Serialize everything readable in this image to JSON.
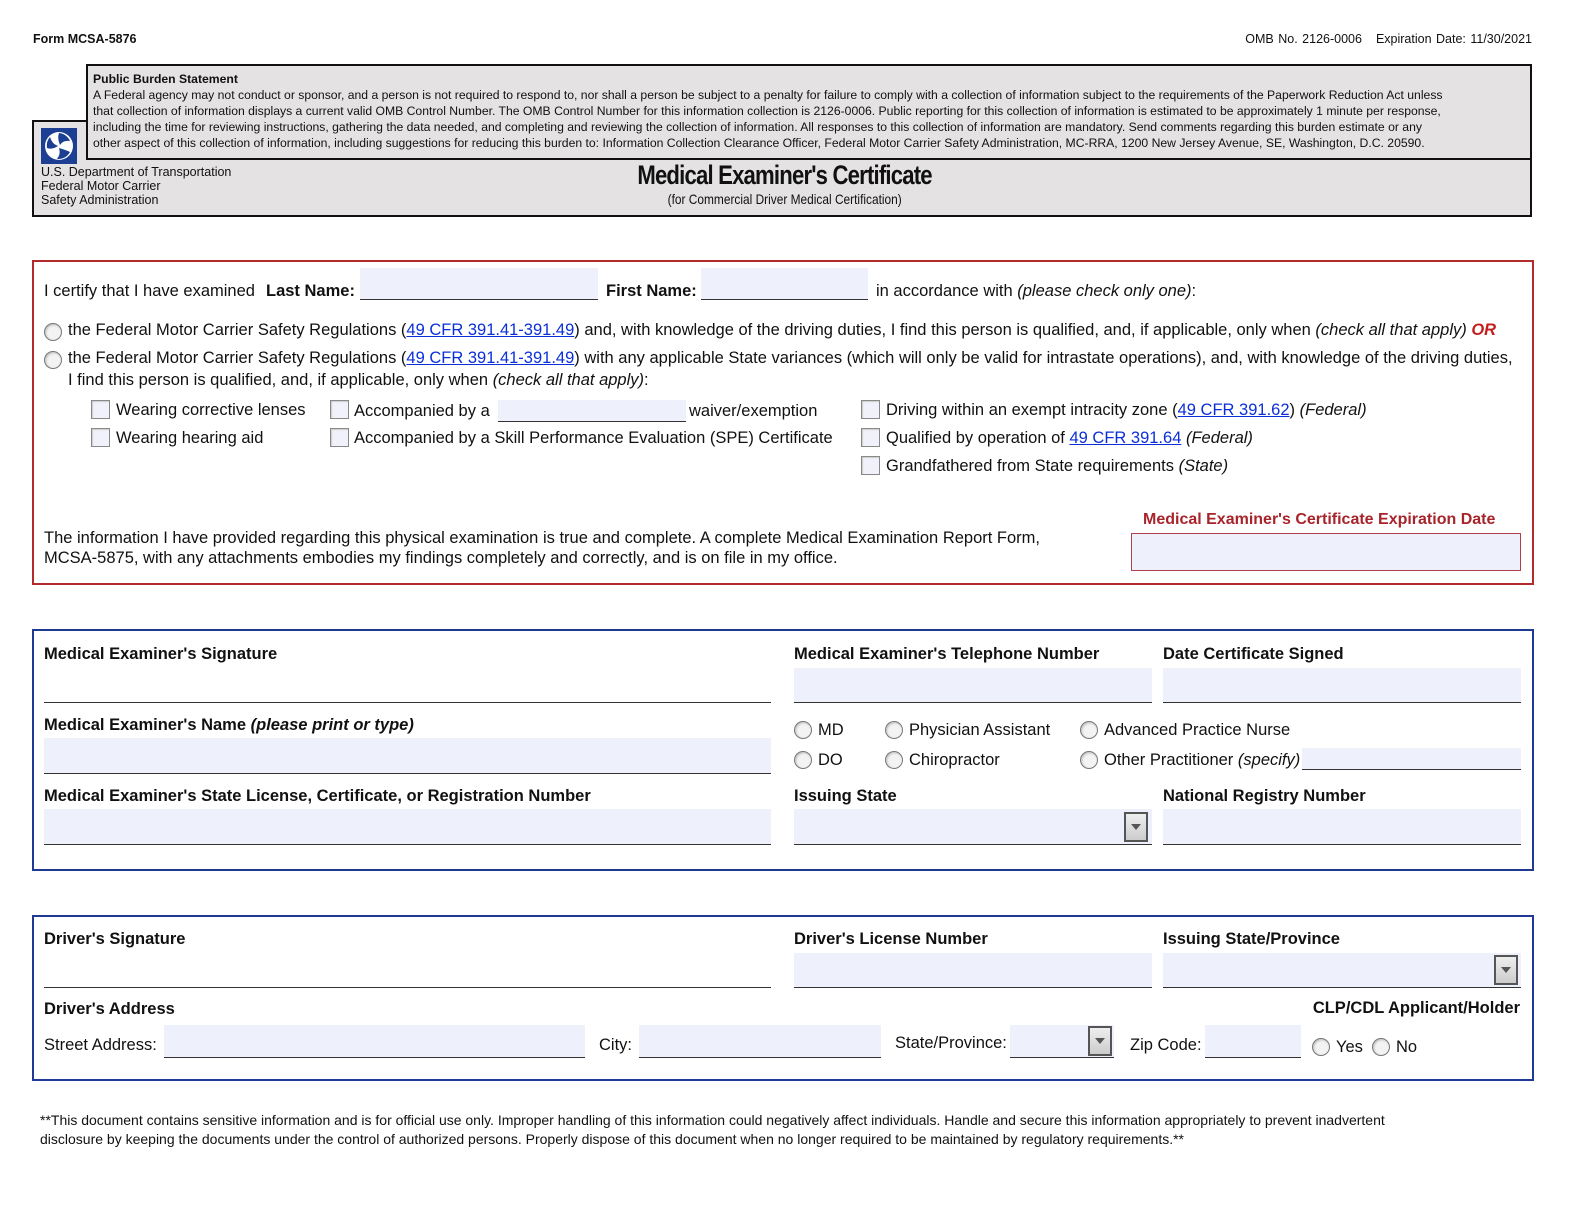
{
  "header": {
    "form_number": "Form MCSA-5876",
    "omb_number": "OMB No. 2126-0006",
    "expiration": "Expiration Date: 11/30/2021",
    "burden_title": "Public Burden Statement",
    "burden_lines": [
      "A Federal agency may not conduct or sponsor, and a person is not required to respond to, nor shall a person be subject to a penalty for failure to comply with a collection of information subject to the requirements of the Paperwork Reduction Act unless",
      "that collection of information displays a current valid OMB Control Number. The OMB Control Number for this information collection is 2126-0006. Public reporting for this collection of information is estimated to be approximately 1 minute per response,",
      "including the time for reviewing instructions, gathering the data needed, and completing and reviewing the collection of information. All responses to this collection of information are mandatory. Send comments regarding this burden estimate or any",
      "other aspect of this collection of information, including suggestions for reducing this burden to: Information Collection Clearance Officer, Federal Motor Carrier Safety Administration, MC-RRA, 1200 New Jersey Avenue, SE, Washington, D.C. 20590."
    ],
    "agency_lines": [
      "U.S. Department of Transportation",
      "Federal Motor Carrier",
      "Safety Administration"
    ],
    "title": "Medical Examiner's Certificate",
    "subtitle": "(for Commercial Driver Medical Certification)",
    "logo_icon": "dot-logo-icon"
  },
  "certification": {
    "intro": "I certify that I have examined",
    "last_name_label": "Last Name:",
    "last_name_value": "",
    "first_name_label": "First Name:",
    "first_name_value": "",
    "accordance": "in accordance with",
    "check_one": "(please check only one)",
    "colon": ":",
    "option1": {
      "pre": "the Federal Motor Carrier Safety Regulations (",
      "link": "49 CFR 391.41-391.49",
      "post": ") and, with knowledge of the driving duties, I find this person is qualified, and, if applicable, only when",
      "italic": "(check all that apply)",
      "or": "OR"
    },
    "option2": {
      "pre": "the Federal Motor Carrier Safety Regulations (",
      "link": "49 CFR 391.41-391.49",
      "post": ") with any applicable State variances (which will only be valid for intrastate operations), and, with knowledge of the driving duties,",
      "line2": "I find this person is qualified, and, if applicable, only when",
      "italic": "(check all that apply)",
      "colon": ":"
    },
    "checkboxes": {
      "corrective_lenses": "Wearing corrective lenses",
      "hearing_aid": "Wearing hearing aid",
      "accompanied_pre": "Accompanied by a",
      "accompanied_value": "",
      "accompanied_post": "waiver/exemption",
      "spe": "Accompanied by a Skill Performance Evaluation (SPE) Certificate",
      "intracity_pre": "Driving within an exempt intracity zone (",
      "intracity_link": "49 CFR 391.62",
      "intracity_post": ")",
      "intracity_tag": "(Federal)",
      "qualified_pre": "Qualified by operation of",
      "qualified_link": "49 CFR 391.64",
      "qualified_tag": "(Federal)",
      "grandfathered": "Grandfathered from State requirements",
      "grandfathered_tag": "(State)"
    },
    "statement_lines": [
      "The information I have provided regarding this physical examination is true and complete. A complete Medical Examination Report Form,",
      "MCSA-5875, with any attachments embodies my findings completely and correctly, and is on file in my office."
    ],
    "expiration_label": "Medical Examiner's Certificate Expiration Date",
    "expiration_value": ""
  },
  "examiner": {
    "signature_label": "Medical Examiner's Signature",
    "phone_label": "Medical Examiner's Telephone Number",
    "phone_value": "",
    "date_label": "Date Certificate Signed",
    "date_value": "",
    "name_label": "Medical Examiner's Name",
    "name_hint": "(please print or type)",
    "name_value": "",
    "credentials": {
      "md": "MD",
      "do": "DO",
      "pa": "Physician Assistant",
      "chiro": "Chiropractor",
      "apn": "Advanced Practice Nurse",
      "other": "Other Practitioner",
      "other_hint": "(specify)",
      "other_value": ""
    },
    "license_label": "Medical Examiner's State License, Certificate, or Registration Number",
    "license_value": "",
    "issuing_state_label": "Issuing State",
    "issuing_state_value": "",
    "registry_label": "National Registry Number",
    "registry_value": ""
  },
  "driver": {
    "signature_label": "Driver's Signature",
    "license_label": "Driver's License Number",
    "license_value": "",
    "issuing_label": "Issuing State/Province",
    "issuing_value": "",
    "address_label": "Driver's Address",
    "clp_label": "CLP/CDL Applicant/Holder",
    "street_label": "Street Address:",
    "street_value": "",
    "city_label": "City:",
    "city_value": "",
    "state_label": "State/Province:",
    "state_value": "",
    "zip_label": "Zip Code:",
    "zip_value": "",
    "yes": "Yes",
    "no": "No"
  },
  "footer": {
    "lines": [
      "**This document contains sensitive information and is for official use only.  Improper handling of this information could negatively affect individuals.  Handle and secure this information appropriately to prevent inadvertent",
      "disclosure by keeping the documents under the control of authorized persons.  Properly dispose of this document when no longer required to be maintained by regulatory requirements.**"
    ]
  },
  "colors": {
    "cert_border": "#b32a2a",
    "section_border": "#1e3a94",
    "field_fill": "#eef0fb",
    "header_fill": "#e4e2e2",
    "link": "#0a2fd8",
    "or_accent": "#c21e1e"
  }
}
